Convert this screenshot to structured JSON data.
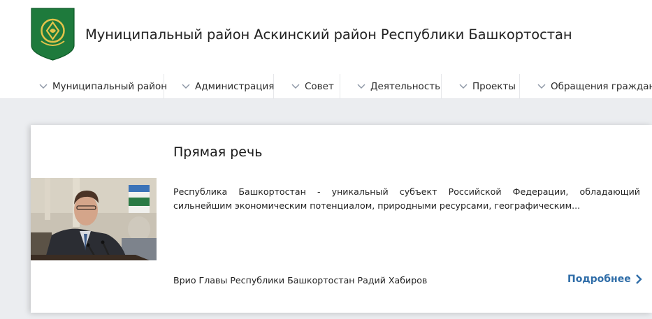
{
  "header": {
    "title": "Муниципальный район Аскинский район Республики Башкортостан",
    "logo_icon": "coat-of-arms-icon"
  },
  "nav": {
    "items": [
      {
        "label": "Муниципальный район"
      },
      {
        "label": "Администрация"
      },
      {
        "label": "Совет"
      },
      {
        "label": "Деятельность"
      },
      {
        "label": "Проекты"
      },
      {
        "label": "Обращения граждан"
      }
    ],
    "chevron_icon": "chevron-down-icon"
  },
  "card": {
    "title": "Прямая речь",
    "quote": "Республика Башкортостан - уникальный субъект Российской Федерации, обладающий сильнейшим экономическим потенциалом, природными ресурсами, географическим...",
    "author": "Врио Главы Республики Башкортостан Радий Хабиров",
    "more_label": "Подробнее",
    "more_icon": "chevron-right-icon"
  },
  "colors": {
    "accent": "#2f6da8",
    "logo_green": "#1e7a3c",
    "page_bg": "#ebedf0"
  }
}
